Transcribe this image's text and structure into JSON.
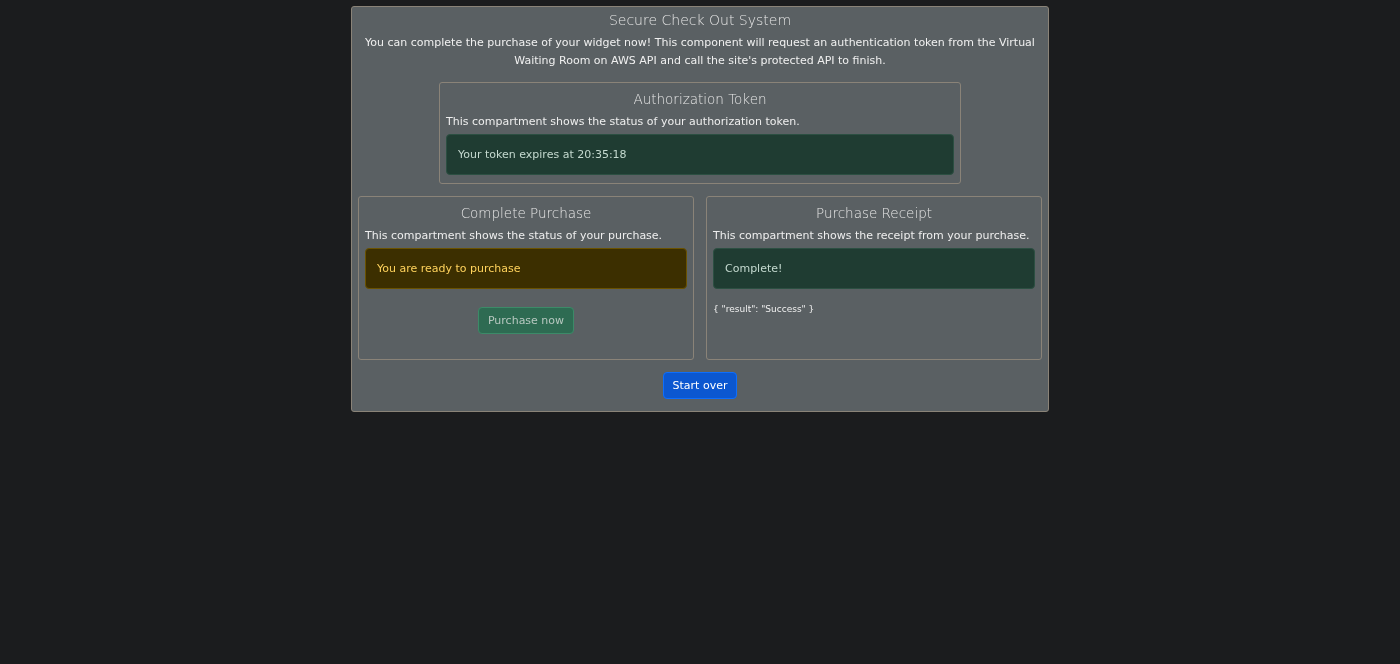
{
  "title": "Secure Check Out System",
  "intro": "You can complete the purchase of your widget now! This component will request an authentication token from the Virtual Waiting Room on AWS API and call the site's protected API to finish.",
  "token_panel": {
    "title": "Authorization Token",
    "description": "This compartment shows the status of your authorization token.",
    "alert": {
      "kind": "success",
      "text": "Your token expires at 20:35:18"
    }
  },
  "purchase_panel": {
    "title": "Complete Purchase",
    "description": "This compartment shows the status of your purchase.",
    "alert": {
      "kind": "warning",
      "text": "You are ready to purchase"
    },
    "button": {
      "label": "Purchase now",
      "disabled": true
    }
  },
  "receipt_panel": {
    "title": "Purchase Receipt",
    "description": "This compartment shows the receipt from your purchase.",
    "alert": {
      "kind": "success",
      "text": "Complete!"
    },
    "result": "{ \"result\": \"Success\" }"
  },
  "start_over_button": "Start over"
}
